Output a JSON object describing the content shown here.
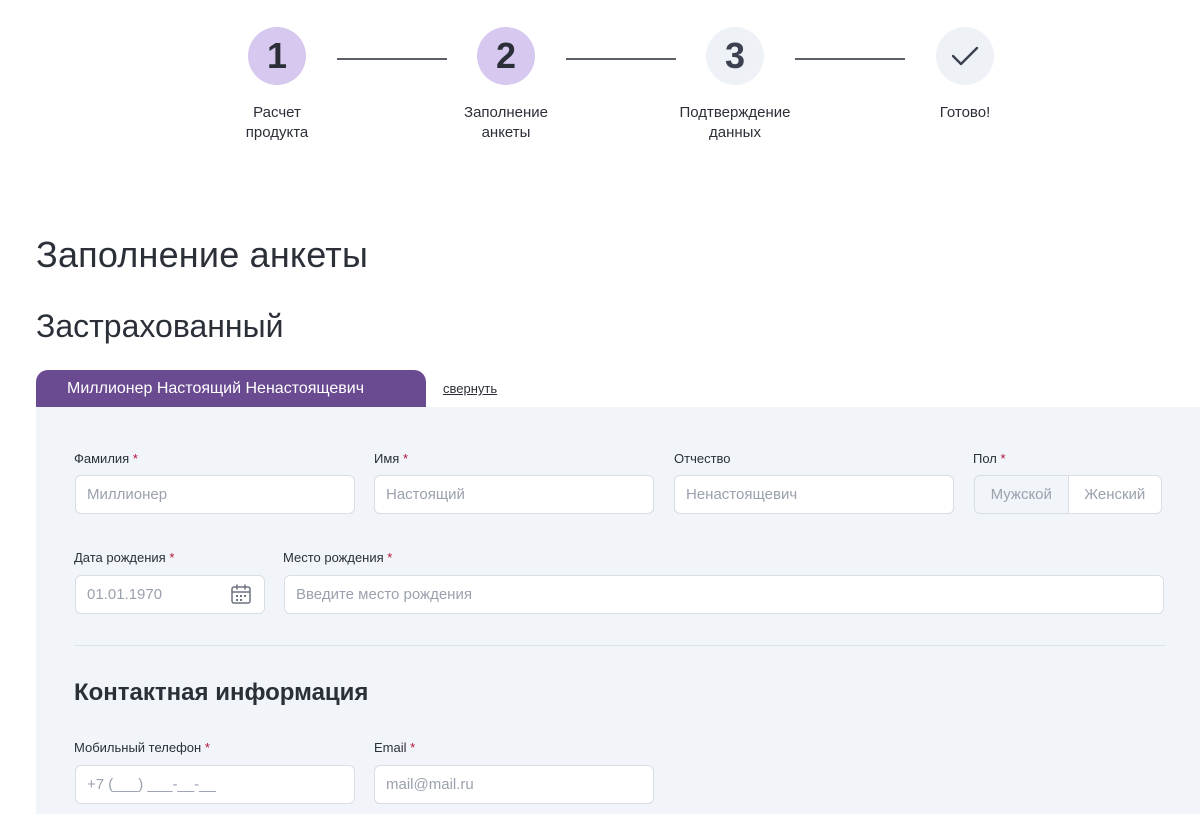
{
  "stepper": {
    "steps": [
      {
        "number": "1",
        "label_line1": "Расчет",
        "label_line2": "продукта",
        "state": "completed"
      },
      {
        "number": "2",
        "label_line1": "Заполнение",
        "label_line2": "анкеты",
        "state": "current"
      },
      {
        "number": "3",
        "label_line1": "Подтверждение",
        "label_line2": "данных",
        "state": "upcoming"
      },
      {
        "number": "",
        "label_line1": "Готово!",
        "label_line2": "",
        "state": "upcoming",
        "icon": "check-icon"
      }
    ]
  },
  "page_title": "Заполнение анкеты",
  "section_title": "Застрахованный",
  "person_tab": {
    "label": "Миллионер Настоящий Ненастоящевич",
    "collapse_link": "свернуть"
  },
  "form": {
    "last_name": {
      "label": "Фамилия",
      "required": "*",
      "placeholder": "Миллионер",
      "value": ""
    },
    "first_name": {
      "label": "Имя",
      "required": "*",
      "placeholder": "Настоящий",
      "value": ""
    },
    "middle_name": {
      "label": "Отчество",
      "placeholder": "Ненастоящевич",
      "value": ""
    },
    "gender": {
      "label": "Пол",
      "required": "*",
      "options": [
        "Мужской",
        "Женский"
      ]
    },
    "birth_date": {
      "label": "Дата рождения",
      "required": "*",
      "placeholder": "01.01.1970",
      "value": "",
      "icon": "calendar-icon"
    },
    "birth_place": {
      "label": "Место рождения",
      "required": "*",
      "placeholder": "Введите место рождения",
      "value": ""
    }
  },
  "contacts": {
    "title": "Контактная информация",
    "phone": {
      "label": "Мобильный телефон",
      "required": "*",
      "placeholder": "+7 (___) ___-__-__",
      "value": ""
    },
    "email": {
      "label": "Email",
      "required": "*",
      "placeholder": "mail@mail.ru",
      "value": ""
    }
  },
  "colors": {
    "accent": "#6a4a90",
    "step_active": "#d6c8ee",
    "step_inactive": "#eef1f6",
    "panel_bg": "#f1f4f9",
    "required": "#b3123a"
  }
}
